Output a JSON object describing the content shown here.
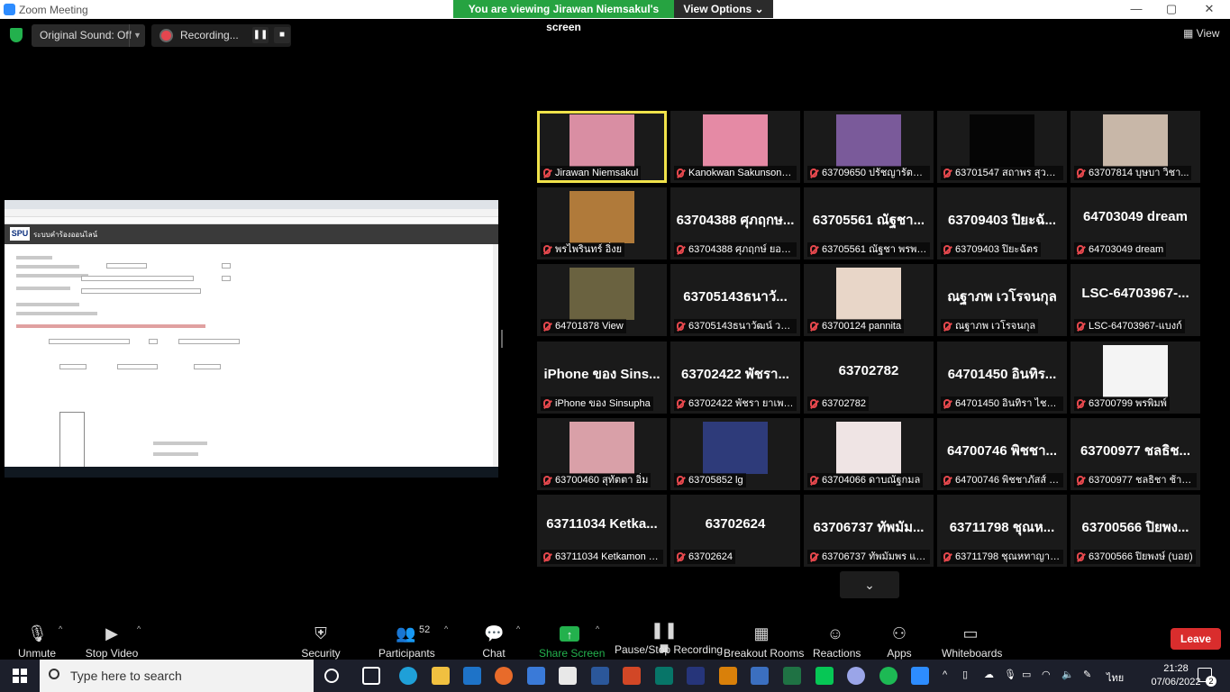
{
  "window": {
    "title": "Zoom Meeting",
    "min": "—",
    "max": "▢",
    "close": "✕"
  },
  "banner": {
    "viewing": "You are viewing Jirawan Niemsakul's screen",
    "view_options": "View Options ⌄"
  },
  "topbar": {
    "original_sound": "Original Sound: Off",
    "recording": "Recording...",
    "view": "View"
  },
  "shared_screen": {
    "logo": "SPU",
    "title": "ระบบคำร้องออนไลน์"
  },
  "participants": [
    {
      "name": "Jirawan Niemsakul",
      "pic": "#d98ea3",
      "active": true
    },
    {
      "name": "Kanokwan Sakunsong...",
      "pic": "#e58aa5"
    },
    {
      "name": "63709650 ปรัชญารัตน์ ...",
      "pic": "#7a5a9a"
    },
    {
      "name": "63701547 สถาพร สุวรร...",
      "pic": "#050505"
    },
    {
      "name": "63707814 บุษบา วิชา...",
      "pic": "#c8b7a8"
    },
    {
      "name": "พรไพรินทร์ อิ่งย",
      "pic": "#b07a3a"
    },
    {
      "name": "63704388 ศุภฤกษ์ ยอดอ...",
      "big": "63704388 ศุภฤกษ..."
    },
    {
      "name": "63705561 ณัฐชา พรพร...",
      "big": "63705561 ณัฐชา..."
    },
    {
      "name": "63709403 ปิยะฉัตร",
      "big": "63709403 ปิยะฉั..."
    },
    {
      "name": "64703049 dream",
      "big": "64703049 dream"
    },
    {
      "name": "64701878 View",
      "pic": "#6a6240"
    },
    {
      "name": "63705143ธนาวัฒน์ วงษ์...",
      "big": "63705143ธนาวั..."
    },
    {
      "name": "63700124 pannita",
      "pic": "#e8d6c8"
    },
    {
      "name": "ณฐาภพ เวโรจนกุล",
      "big": "ณฐาภพ เวโรจนกุล"
    },
    {
      "name": "LSC-64703967-แบงก์",
      "big": "LSC-64703967-..."
    },
    {
      "name": "iPhone ของ Sinsupha",
      "big": "iPhone ของ Sins..."
    },
    {
      "name": "63702422 พัชรา ยาเพชร",
      "big": "63702422 พัชรา..."
    },
    {
      "name": "63702782",
      "big": "63702782"
    },
    {
      "name": "64701450 อินทิรา ไชยา...",
      "big": "64701450 อินทิร..."
    },
    {
      "name": "63700799 พรพิมพ์",
      "pic": "#f4f4f4"
    },
    {
      "name": "63700460 สุทัตตา อิ่ม",
      "pic": "#d9a0a8"
    },
    {
      "name": "63705852 lg",
      "pic": "#2e3b7a"
    },
    {
      "name": "63704066 ดาบณัฐกมล",
      "pic": "#efe4e4"
    },
    {
      "name": "64700746 พิชชาภัสส์ อิ...",
      "big": "64700746 พิชชา..."
    },
    {
      "name": "63700977 ชลธิชา ช้างเ...",
      "big": "63700977 ชลธิช..."
    },
    {
      "name": "63711034 Ketkamon T...",
      "big": "63711034 Ketka..."
    },
    {
      "name": "63702624",
      "big": "63702624"
    },
    {
      "name": "63706737 ทัพมัมพร แพงไ...",
      "big": "63706737 ทัพมัม..."
    },
    {
      "name": "63711798 ชุณหทาญาจน์...",
      "big": "63711798 ชุณห..."
    },
    {
      "name": "63700566 ปิยพงษ์ (บอย)",
      "big": "63700566 ปิยพง..."
    }
  ],
  "toolbar": {
    "unmute": "Unmute",
    "stop_video": "Stop Video",
    "security": "Security",
    "participants": "Participants",
    "participant_count": "52",
    "chat": "Chat",
    "share_screen": "Share Screen",
    "pause_recording": "Pause/Stop Recording",
    "breakout": "Breakout Rooms",
    "reactions": "Reactions",
    "apps": "Apps",
    "whiteboards": "Whiteboards",
    "leave": "Leave"
  },
  "taskbar": {
    "search_placeholder": "Type here to search",
    "lang": "ไทย",
    "time": "21:28",
    "date": "07/06/2022",
    "notifications": "2"
  },
  "icons": [
    "shield-icon",
    "mic-off-icon",
    "video-icon",
    "participants-icon",
    "chat-icon",
    "share-icon",
    "pause-icon",
    "breakout-icon",
    "reactions-icon",
    "apps-icon",
    "whiteboard-icon",
    "chevron-down-icon"
  ]
}
